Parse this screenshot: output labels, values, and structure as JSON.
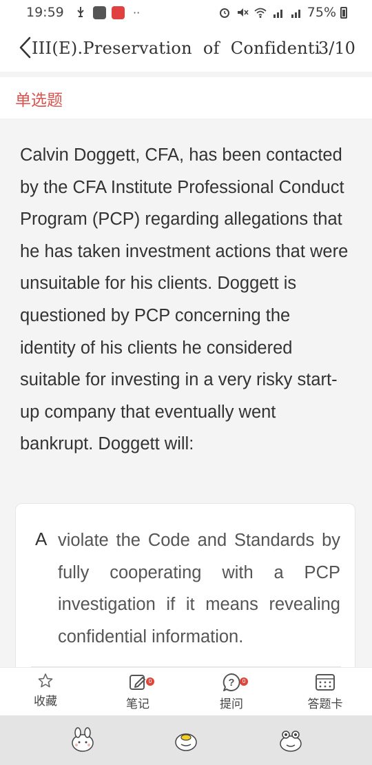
{
  "status_bar": {
    "time": "19:59",
    "network": "4G",
    "battery": "75%",
    "overflow": "··"
  },
  "header": {
    "title": "III(E).Preservation of Confidentiality",
    "progress": "3/10"
  },
  "question": {
    "type_label": "单选题",
    "stem": "Calvin Doggett, CFA, has been contacted by the CFA Institute Professional Conduct Program (PCP) regarding allegations that he has taken investment actions that were unsuitable for his clients. Doggett is questioned by PCP concerning the identity of his clients he considered suitable for investing in a very risky start-up company that eventually went bankrupt. Doggett will:"
  },
  "options": [
    {
      "letter": "A",
      "text": "violate the Code and Standards by fully cooperating with a PCP investigation if it means revealing confidential information."
    }
  ],
  "toolbar": {
    "favorite": "收藏",
    "notes": "笔记",
    "ask": "提问",
    "answer_sheet": "答题卡",
    "notes_badge": "0",
    "ask_badge": "0"
  },
  "icons": {
    "back": "chevron-left-icon",
    "favorite": "star-icon",
    "notes": "edit-note-icon",
    "ask": "question-bubble-icon",
    "answer_sheet": "grid-card-icon"
  },
  "colors": {
    "accent_red": "#d9534f",
    "badge_red": "#e0453a",
    "text_dark": "#333333"
  }
}
